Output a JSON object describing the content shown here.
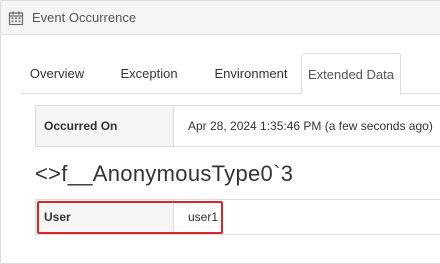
{
  "panel": {
    "title": "Event Occurrence",
    "icon": "calendar-icon"
  },
  "tabs": [
    {
      "label": "Overview",
      "active": false
    },
    {
      "label": "Exception",
      "active": false
    },
    {
      "label": "Environment",
      "active": false
    },
    {
      "label": "Extended Data",
      "active": true
    }
  ],
  "occurred": {
    "label": "Occurred On",
    "value": "Apr 28, 2024 1:35:46 PM (a few seconds ago)"
  },
  "extended": {
    "type_name": "<>f__AnonymousType0`3",
    "rows": [
      {
        "key": "User",
        "value": "user1"
      }
    ]
  },
  "colors": {
    "highlight": "#d9262b",
    "header_bg": "#f5f5f5"
  }
}
